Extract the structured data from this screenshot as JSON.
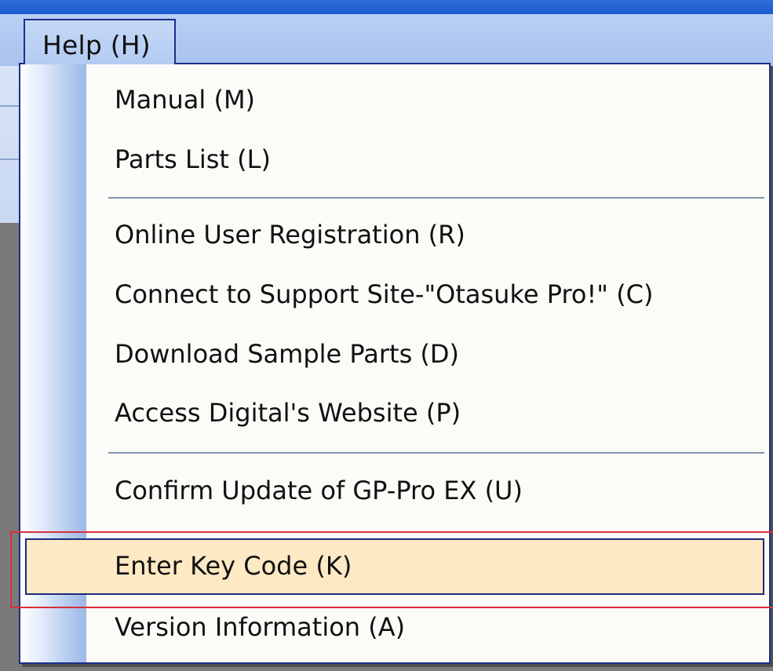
{
  "menu": {
    "title": "Help (H)",
    "items": [
      {
        "label": "Manual (M)"
      },
      {
        "label": "Parts List (L)"
      },
      {
        "label": "Online User Registration (R)"
      },
      {
        "label": "Connect to Support Site-\"Otasuke Pro!\" (C)"
      },
      {
        "label": "Download Sample Parts (D)"
      },
      {
        "label": "Access Digital's Website (P)"
      },
      {
        "label": "Confirm Update of GP-Pro EX (U)"
      },
      {
        "label": "Enter Key Code (K)"
      },
      {
        "label": "Version Information (A)"
      }
    ],
    "highlighted_item": "Enter Key Code (K)"
  },
  "colors": {
    "highlight_fill": "#fde9c4",
    "annotation_box": "#d8303a",
    "menu_border": "#1c2f8a"
  }
}
